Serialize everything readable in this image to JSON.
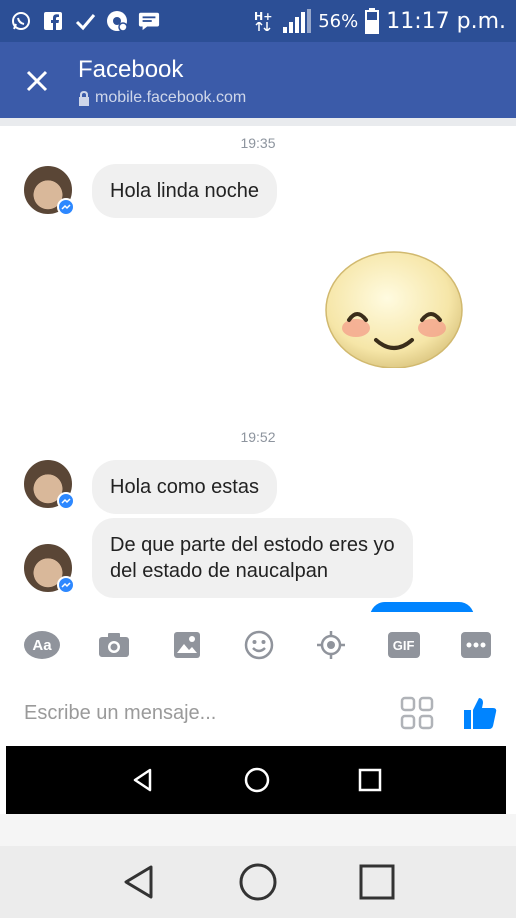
{
  "status_bar": {
    "left_icons": [
      "whatsapp-icon",
      "facebook-icon",
      "check-icon",
      "google-photos-icon",
      "message-icon"
    ],
    "network": "H+",
    "battery_percent": "56%",
    "time": "11:17 p.m."
  },
  "app_bar": {
    "title": "Facebook",
    "url": "mobile.facebook.com"
  },
  "chat": {
    "messages": [
      {
        "time": "19:35",
        "text": "Hola linda noche"
      },
      {
        "time": "19:52",
        "text": "Hola como estas"
      },
      {
        "text_line1": "De que parte del estodo eres yo",
        "text_line2": "del estado de naucalpan"
      }
    ]
  },
  "composer": {
    "placeholder": "Escribe un mensaje...",
    "aa_label": "Aa",
    "gif_label": "GIF"
  },
  "colors": {
    "status_bar": "#2c4f96",
    "app_bar": "#3b5ba9",
    "bubble_incoming": "#f0f0f0",
    "messenger_blue": "#0084ff"
  }
}
